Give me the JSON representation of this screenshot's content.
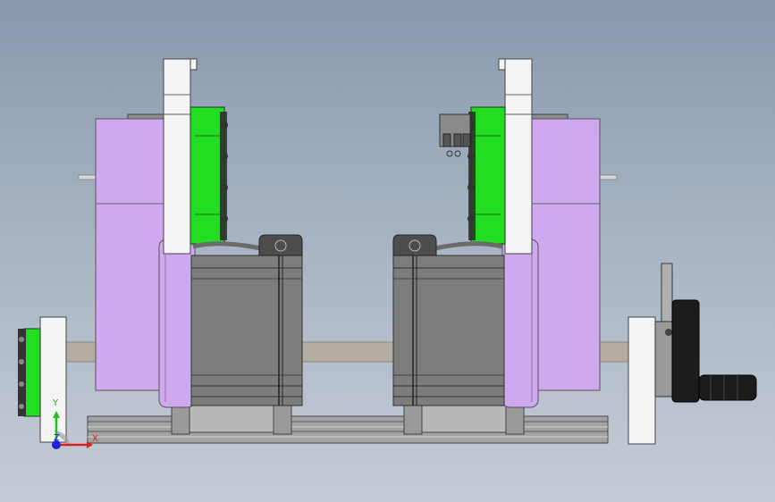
{
  "colors": {
    "background_top": "#8899ad",
    "background_bottom": "#c5ccd6",
    "purple_housing": "#cfa8ef",
    "green_gear": "#22dd22",
    "motor_gray": "#7d7d7d",
    "bracket_white": "#f4f4f4",
    "rail_gray": "#9a9a9a",
    "shaft": "#b4aca0",
    "handle_black": "#1c1c1c",
    "axis_x": "#e02020",
    "axis_y": "#20c020",
    "axis_z": "#2020e0"
  },
  "triad": {
    "x_label": "X",
    "y_label": "Y",
    "z_label": "Z"
  }
}
